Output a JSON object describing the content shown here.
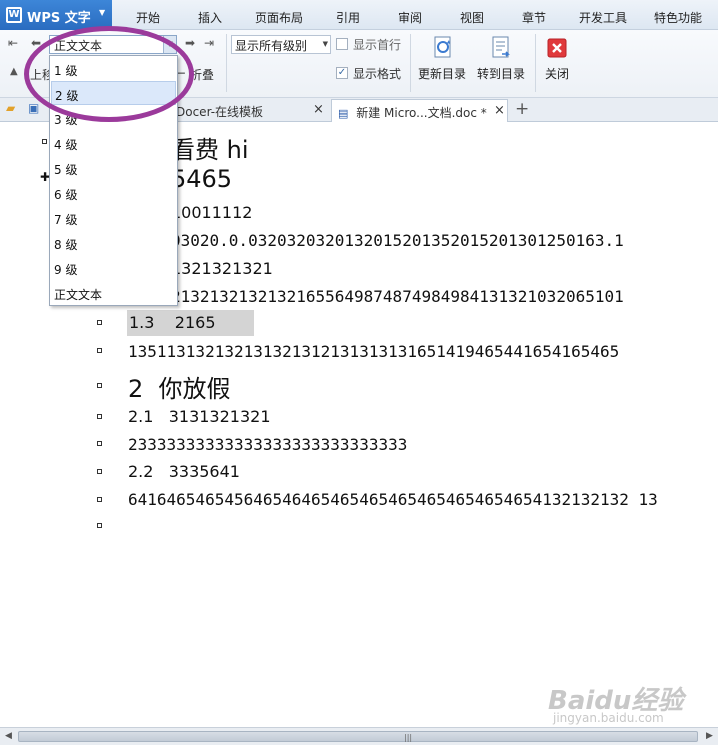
{
  "app": {
    "name": "WPS 文字",
    "logo_letter": "W"
  },
  "menu": [
    "开始",
    "插入",
    "页面布局",
    "引用",
    "审阅",
    "视图",
    "章节",
    "开发工具",
    "特色功能"
  ],
  "ribbon": {
    "level_select_value": "正文文本",
    "show_level_value": "显示所有级别",
    "show_first_line_label": "显示首行",
    "show_format_label": "显示格式",
    "update_toc_label": "更新目录",
    "goto_toc_label": "转到目录",
    "close_label": "关闭",
    "move_up_label": "上移",
    "collapse_label": "折叠",
    "show_first_line_checked": false,
    "show_format_checked": true
  },
  "tabs": [
    {
      "label": "Docer-在线模板",
      "close": "×"
    },
    {
      "label": "新建 Micro...文档.doc *",
      "close": "×"
    }
  ],
  "new_tab_symbol": "+",
  "dropdown": {
    "items": [
      "1 级",
      "2 级",
      "3 级",
      "4 级",
      "5 级",
      "6 级",
      "7 级",
      "8 级",
      "9 级",
      "正文文本"
    ],
    "highlighted_index": 1
  },
  "document": {
    "lines": [
      "看费 hi",
      "5465",
      "10011112",
      "03020.0.0320320320132015201352015201301250163.1",
      "1321321321",
      "21321321321321655649874874984984131321032065101",
      "1.3    2165",
      "135113132132131321312131313131651419465441654165465",
      "2  你放假",
      "2.1   3131321321",
      "23333333333333333333333333333",
      "2.2   3335641",
      "6416465465456465464654654654654654654654654132132132 13"
    ]
  },
  "watermark": {
    "brand": "Baidu经验",
    "url": "jingyan.baidu.com"
  },
  "colors": {
    "wps_blue": "#2a6cc0",
    "highlight_circle": "#9b3a9b",
    "selection": "#d4d4d4"
  }
}
